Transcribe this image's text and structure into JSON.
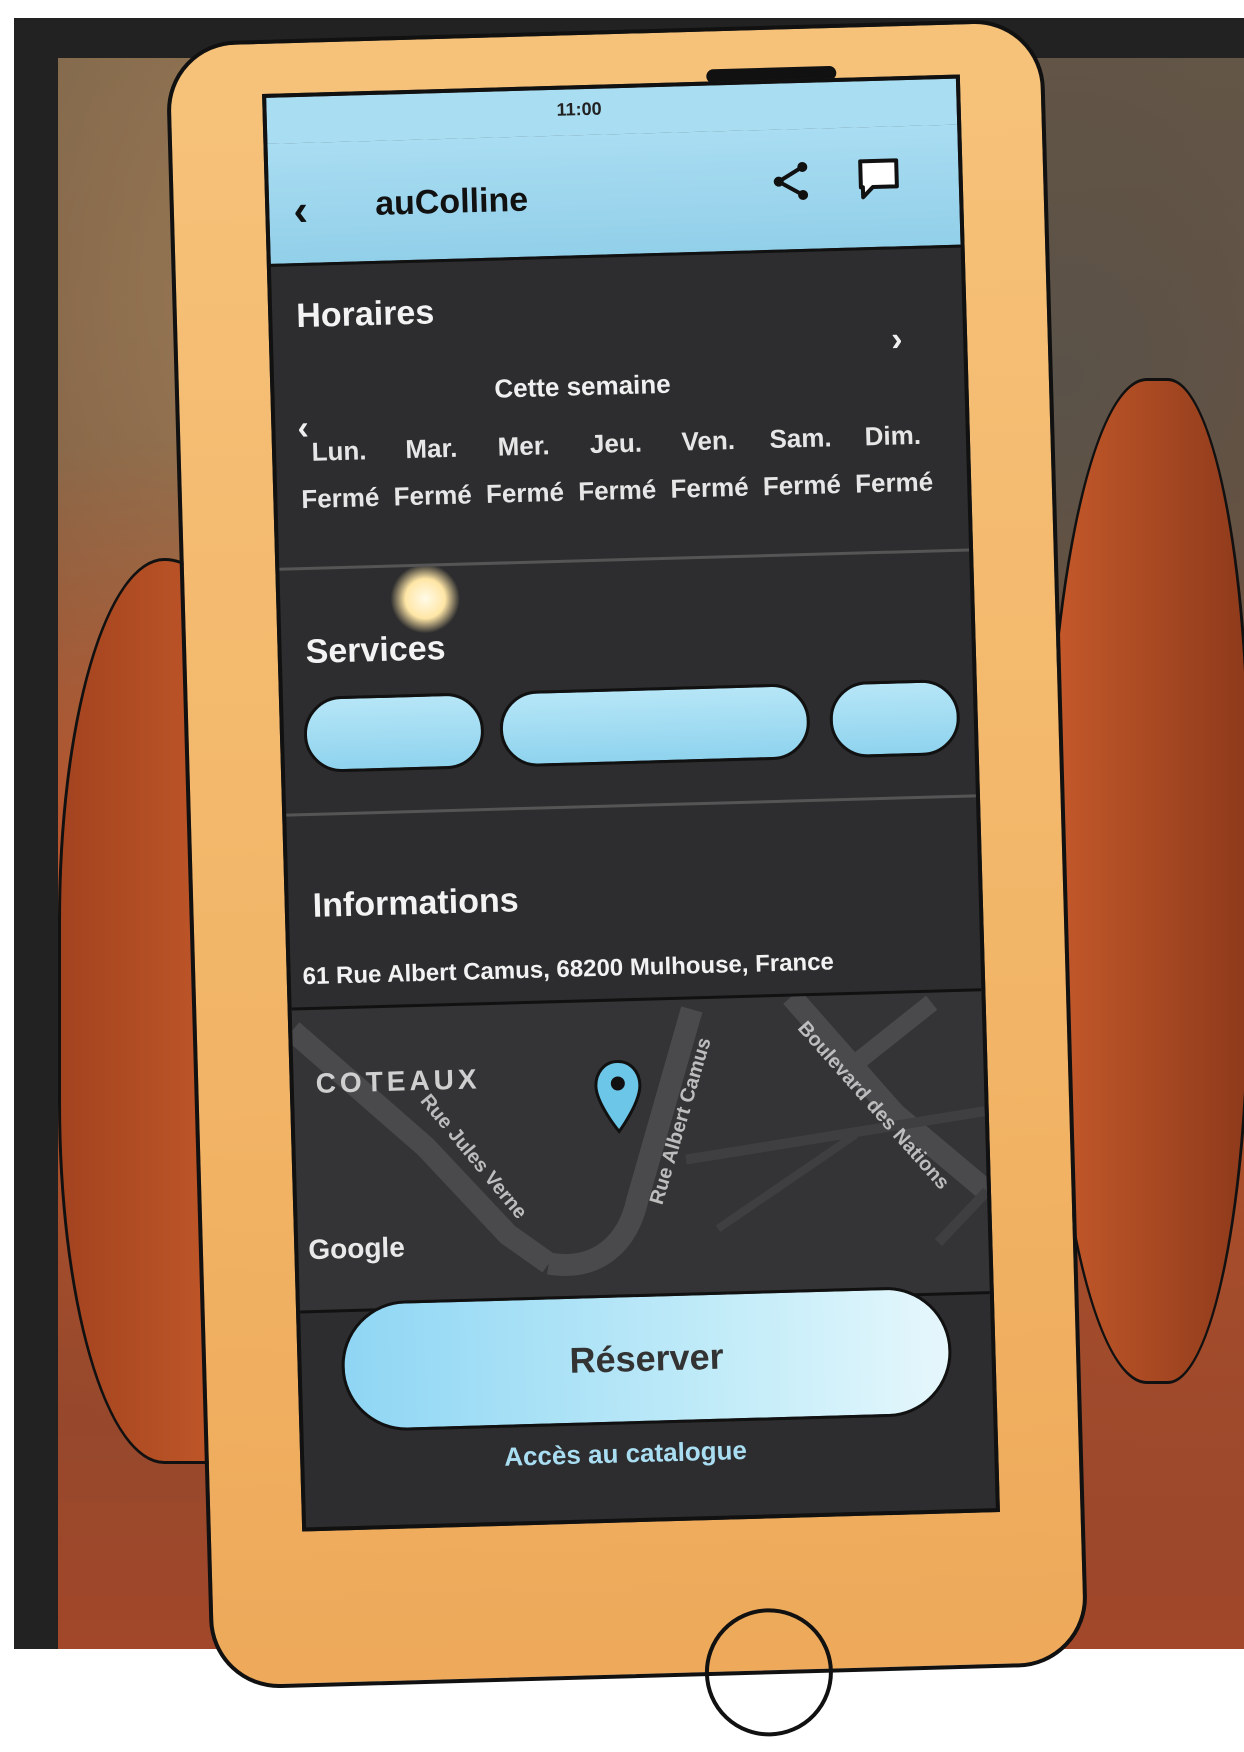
{
  "status_bar": {
    "carrier": "",
    "time": "11:00",
    "battery": ""
  },
  "nav": {
    "title": "auColline",
    "back_icon": "chevron-left-icon",
    "share_icon": "share-icon",
    "chat_icon": "chat-bubble-icon"
  },
  "hours": {
    "title": "Horaires",
    "week_label": "Cette semaine",
    "days": [
      {
        "name": "Lun.",
        "status": "Fermé"
      },
      {
        "name": "Mar.",
        "status": "Fermé"
      },
      {
        "name": "Mer.",
        "status": "Fermé"
      },
      {
        "name": "Jeu.",
        "status": "Fermé"
      },
      {
        "name": "Ven.",
        "status": "Fermé"
      },
      {
        "name": "Sam.",
        "status": "Fermé"
      },
      {
        "name": "Dim.",
        "status": "Fermé"
      }
    ]
  },
  "services": {
    "title": "Services",
    "chips": [
      "",
      "",
      ""
    ]
  },
  "information": {
    "title": "Informations",
    "address": "61 Rue Albert Camus, 68200 Mulhouse, France"
  },
  "map": {
    "district": "COTEAUX",
    "attribution": "Google",
    "streets": [
      "Rue Albert Camus",
      "Boulevard des Nations",
      "Rue Jules Verne"
    ]
  },
  "actions": {
    "reserve_label": "Réserver",
    "catalog_label": "Accès au catalogue"
  },
  "colors": {
    "accent": "#a9ddf2",
    "screen_bg": "#2d2d2f",
    "phone_body": "#f2b567"
  }
}
